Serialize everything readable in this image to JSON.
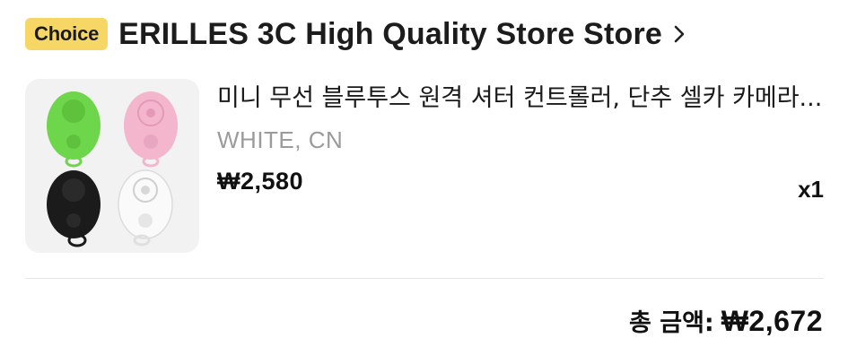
{
  "store": {
    "badge": "Choice",
    "name": "ERILLES 3C High Quality Store Store",
    "chevron_icon": "chevron-right-icon",
    "badge_color": "#f6d766"
  },
  "item": {
    "image_icon": "bluetooth-remote-shutter-product-image",
    "title": "미니 무선 블루투스 원격 셔터 컨트롤러, 단추 셀카 카메라...",
    "variant": "WHITE, CN",
    "price": "₩2,580",
    "quantity": "x1"
  },
  "summary": {
    "total_label": "총 금액:",
    "total_value": "₩2,672"
  }
}
